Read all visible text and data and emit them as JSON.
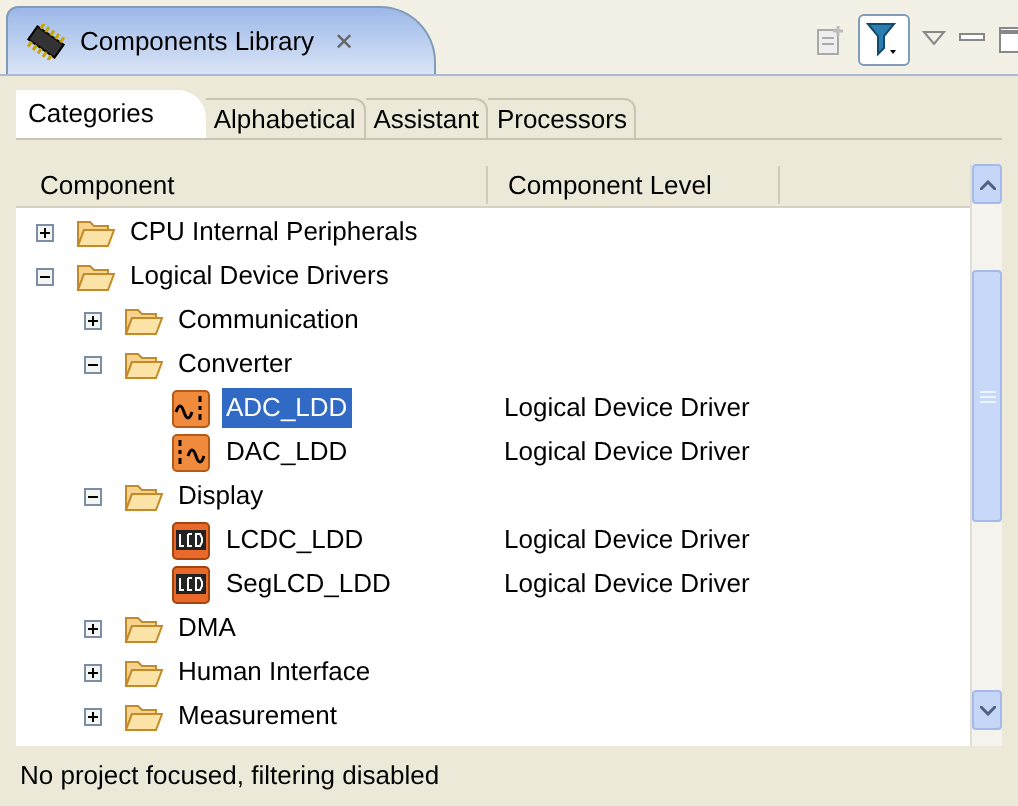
{
  "view": {
    "title": "Components Library",
    "close": "✕"
  },
  "tabs": [
    {
      "label": "Categories",
      "selected": true
    },
    {
      "label": "Alphabetical",
      "selected": false
    },
    {
      "label": "Assistant",
      "selected": false
    },
    {
      "label": "Processors",
      "selected": false
    }
  ],
  "table": {
    "columns": [
      "Component",
      "Component Level"
    ],
    "rows": [
      {
        "kind": "folder",
        "label": "CPU Internal Peripherals",
        "expanded": false,
        "selected": false
      },
      {
        "kind": "folder",
        "label": "Logical Device Drivers",
        "expanded": true,
        "selected": false,
        "children": [
          {
            "kind": "folder",
            "label": "Communication",
            "expanded": false,
            "selected": false
          },
          {
            "kind": "folder",
            "label": "Converter",
            "expanded": true,
            "selected": false,
            "children": [
              {
                "kind": "wave-in",
                "label": "ADC_LDD",
                "level": "Logical Device Driver",
                "selected": true
              },
              {
                "kind": "wave-out",
                "label": "DAC_LDD",
                "level": "Logical Device Driver",
                "selected": false
              }
            ]
          },
          {
            "kind": "folder",
            "label": "Display",
            "expanded": true,
            "selected": false,
            "children": [
              {
                "kind": "lcd",
                "label": "LCDC_LDD",
                "level": "Logical Device Driver",
                "selected": false
              },
              {
                "kind": "lcd",
                "label": "SegLCD_LDD",
                "level": "Logical Device Driver",
                "selected": false
              }
            ]
          },
          {
            "kind": "folder",
            "label": "DMA",
            "expanded": false,
            "selected": false
          },
          {
            "kind": "folder",
            "label": "Human Interface",
            "expanded": false,
            "selected": false
          },
          {
            "kind": "folder",
            "label": "Measurement",
            "expanded": false,
            "selected": false
          }
        ]
      }
    ]
  },
  "status_bar": "No project focused, filtering disabled"
}
